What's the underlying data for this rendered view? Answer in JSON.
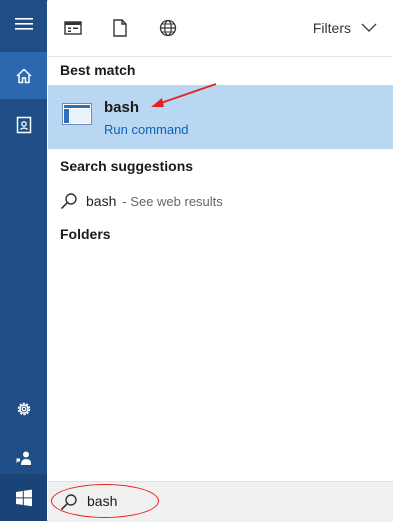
{
  "header": {
    "filters_label": "Filters"
  },
  "results": {
    "best_match_title": "Best match",
    "best_match": {
      "name": "bash",
      "subtitle": "Run command"
    },
    "suggestions_title": "Search suggestions",
    "suggestion": {
      "term": "bash",
      "hint": "- See web results"
    },
    "folders_title": "Folders"
  },
  "search": {
    "value": "bash"
  },
  "icons": {
    "menu": "hamburger-icon",
    "home": "home-icon",
    "notebook": "notebook-icon",
    "settings": "gear-icon",
    "feedback": "feedback-icon",
    "start": "windows-logo-icon",
    "apps": "apps-filter-icon",
    "documents": "documents-filter-icon",
    "web": "web-filter-icon",
    "search": "search-icon",
    "command": "run-command-icon"
  },
  "colors": {
    "rail": "#1f4e86",
    "rail_active": "#2b68b0",
    "selection": "#b9d7f3",
    "link": "#0a64b7",
    "annotation": "#e52222"
  }
}
